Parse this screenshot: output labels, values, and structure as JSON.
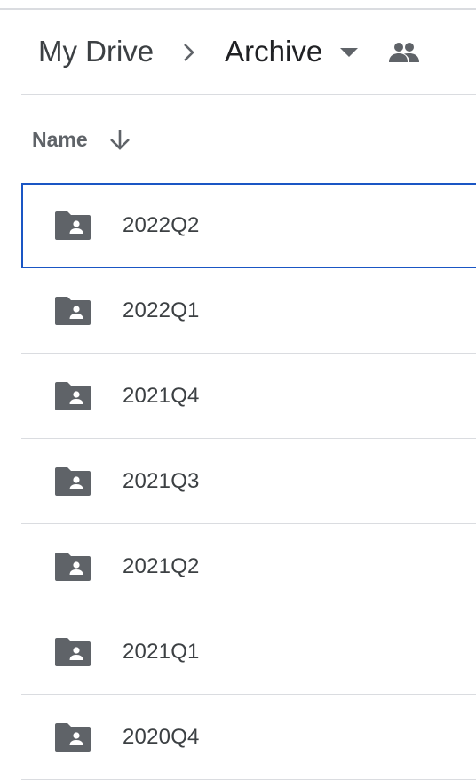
{
  "breadcrumb": {
    "root_label": "My Drive",
    "current_label": "Archive"
  },
  "icons": {
    "separator": "chevron-right-icon",
    "dropdown": "caret-down-icon",
    "shared": "people-icon",
    "sort": "arrow-down-icon",
    "folder": "shared-folder-icon"
  },
  "columns": {
    "name_label": "Name"
  },
  "files": [
    {
      "name": "2022Q2",
      "selected": true
    },
    {
      "name": "2022Q1",
      "selected": false
    },
    {
      "name": "2021Q4",
      "selected": false
    },
    {
      "name": "2021Q3",
      "selected": false
    },
    {
      "name": "2021Q2",
      "selected": false
    },
    {
      "name": "2021Q1",
      "selected": false
    },
    {
      "name": "2020Q4",
      "selected": false
    }
  ],
  "colors": {
    "icon": "#5f6368",
    "selection_border": "#1a56c4",
    "divider": "#dadce0"
  }
}
